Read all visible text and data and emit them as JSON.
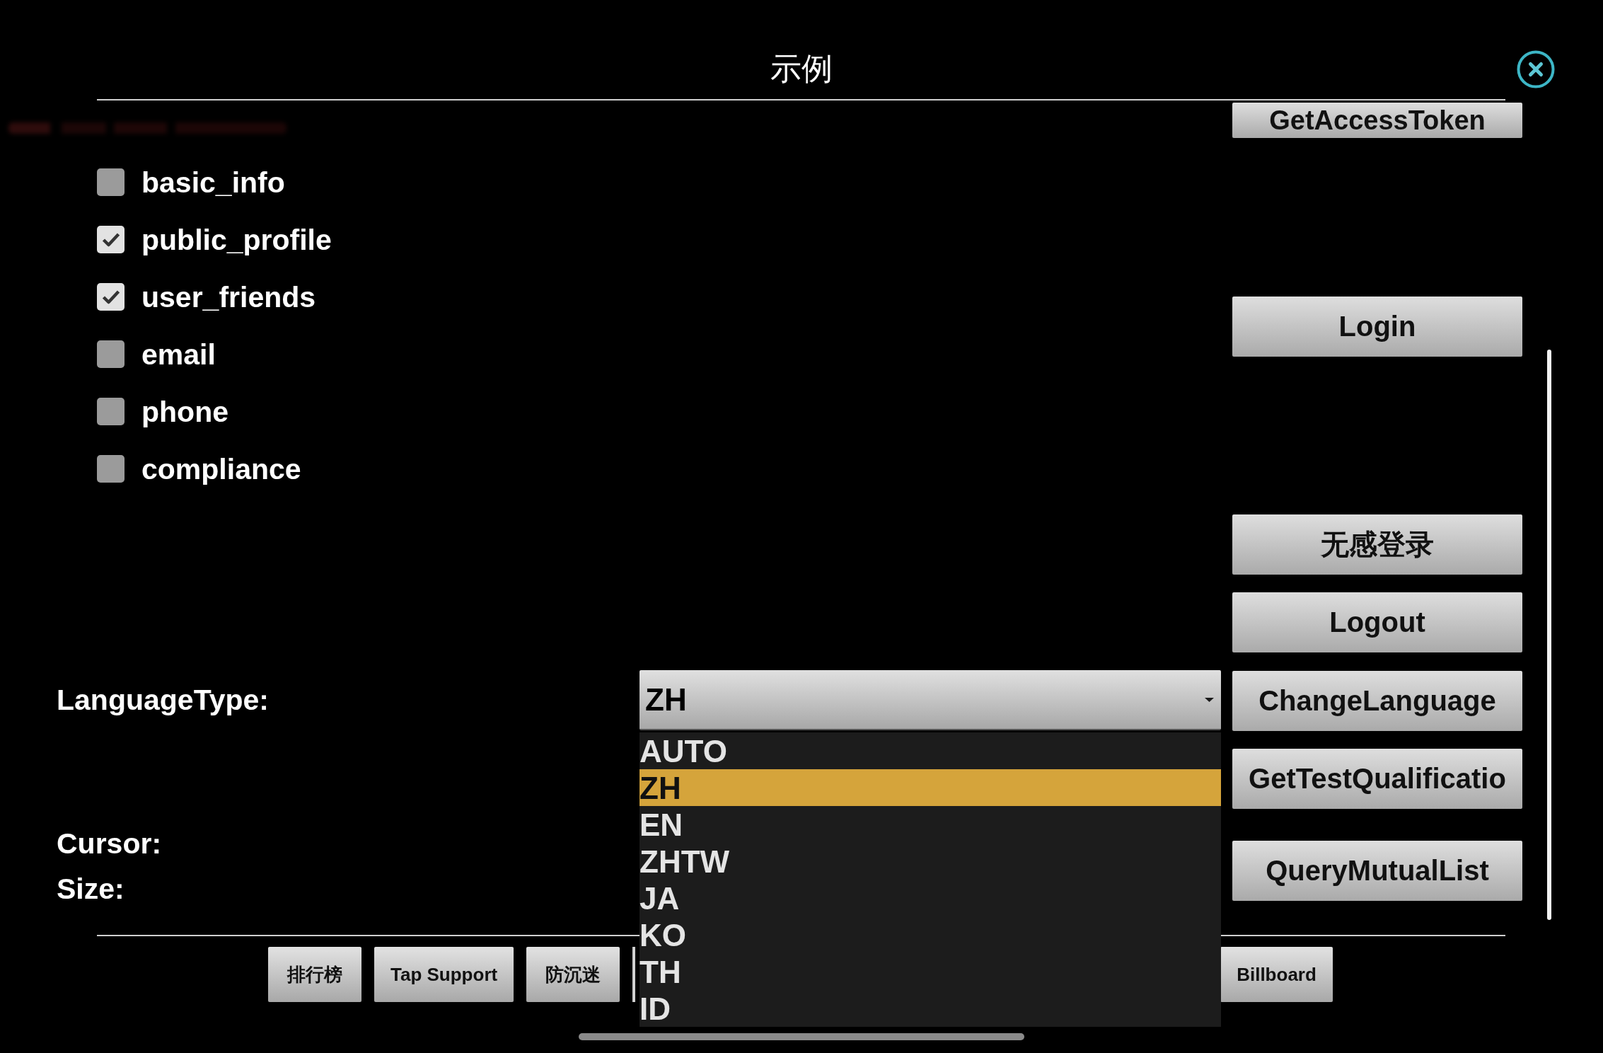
{
  "dialog": {
    "title": "示例"
  },
  "permissions": [
    {
      "label": "basic_info",
      "checked": false
    },
    {
      "label": "public_profile",
      "checked": true
    },
    {
      "label": "user_friends",
      "checked": true
    },
    {
      "label": "email",
      "checked": false
    },
    {
      "label": "phone",
      "checked": false
    },
    {
      "label": "compliance",
      "checked": false
    }
  ],
  "language": {
    "label": "LanguageType:",
    "value": "ZH",
    "expanded": true,
    "options": [
      {
        "label": "AUTO",
        "selected": false
      },
      {
        "label": "ZH",
        "selected": true
      },
      {
        "label": "EN",
        "selected": false
      },
      {
        "label": "ZHTW",
        "selected": false
      },
      {
        "label": "JA",
        "selected": false
      },
      {
        "label": "KO",
        "selected": false
      },
      {
        "label": "TH",
        "selected": false
      },
      {
        "label": "ID",
        "selected": false
      }
    ]
  },
  "info_labels": [
    "Cursor:",
    "Size:"
  ],
  "side_buttons": [
    "GetAccessToken",
    "Login",
    "无感登录",
    "Logout",
    "ChangeLanguage",
    "GetTestQualificatio",
    "QueryMutualList"
  ],
  "bottom_buttons": [
    "排行榜",
    "Tap Support",
    "防沉迷",
    "Billboard"
  ]
}
